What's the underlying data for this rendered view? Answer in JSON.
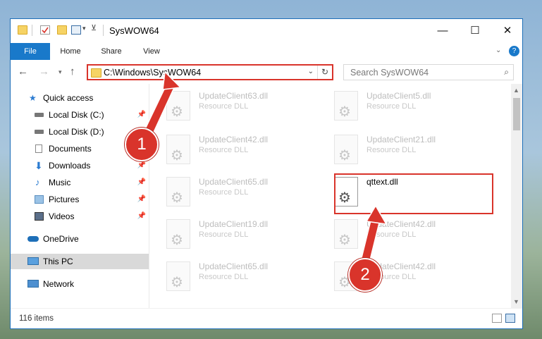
{
  "window": {
    "title": "SysWOW64",
    "minimize": "—",
    "maximize": "☐",
    "close": "✕"
  },
  "ribbon": {
    "tabs": [
      "File",
      "Home",
      "Share",
      "View"
    ],
    "help": "?"
  },
  "address": {
    "path": "C:\\Windows\\SysWOW64",
    "search_placeholder": "Search SysWOW64"
  },
  "nav": {
    "items": [
      {
        "label": "Quick access",
        "icon": "star-icon"
      },
      {
        "label": "Local Disk (C:)",
        "icon": "drive-icon",
        "pinned": true
      },
      {
        "label": "Local Disk (D:)",
        "icon": "drive-icon"
      },
      {
        "label": "Documents",
        "icon": "documents-icon"
      },
      {
        "label": "Downloads",
        "icon": "downloads-icon",
        "pinned": true
      },
      {
        "label": "Music",
        "icon": "music-icon",
        "pinned": true
      },
      {
        "label": "Pictures",
        "icon": "pictures-icon",
        "pinned": true
      },
      {
        "label": "Videos",
        "icon": "videos-icon",
        "pinned": true
      },
      {
        "label": "OneDrive",
        "icon": "cloud-icon"
      },
      {
        "label": "This PC",
        "icon": "pc-icon",
        "selected": true
      },
      {
        "label": "Network",
        "icon": "network-icon"
      }
    ]
  },
  "files": [
    {
      "name": "UpdateClient63.dll",
      "type": "Resource DLL"
    },
    {
      "name": "UpdateClient5.dll",
      "type": "Resource DLL"
    },
    {
      "name": "UpdateClient42.dll",
      "type": "Resource DLL"
    },
    {
      "name": "UpdateClient21.dll",
      "type": "Resource DLL"
    },
    {
      "name": "UpdateClient65.dll",
      "type": "Resource DLL"
    },
    {
      "name": "qttext.dll",
      "type": ""
    },
    {
      "name": "UpdateClient19.dll",
      "type": "Resource DLL"
    },
    {
      "name": "UpdateClient42.dll",
      "type": "Resource DLL"
    },
    {
      "name": "UpdateClient65.dll",
      "type": "Resource DLL"
    },
    {
      "name": "UpdateClient42.dll",
      "type": "Resource DLL"
    }
  ],
  "status": {
    "item_count": "116 items"
  },
  "callouts": {
    "step1": "1",
    "step2": "2"
  },
  "colors": {
    "accent": "#1979ca",
    "highlight": "#d9342b"
  }
}
